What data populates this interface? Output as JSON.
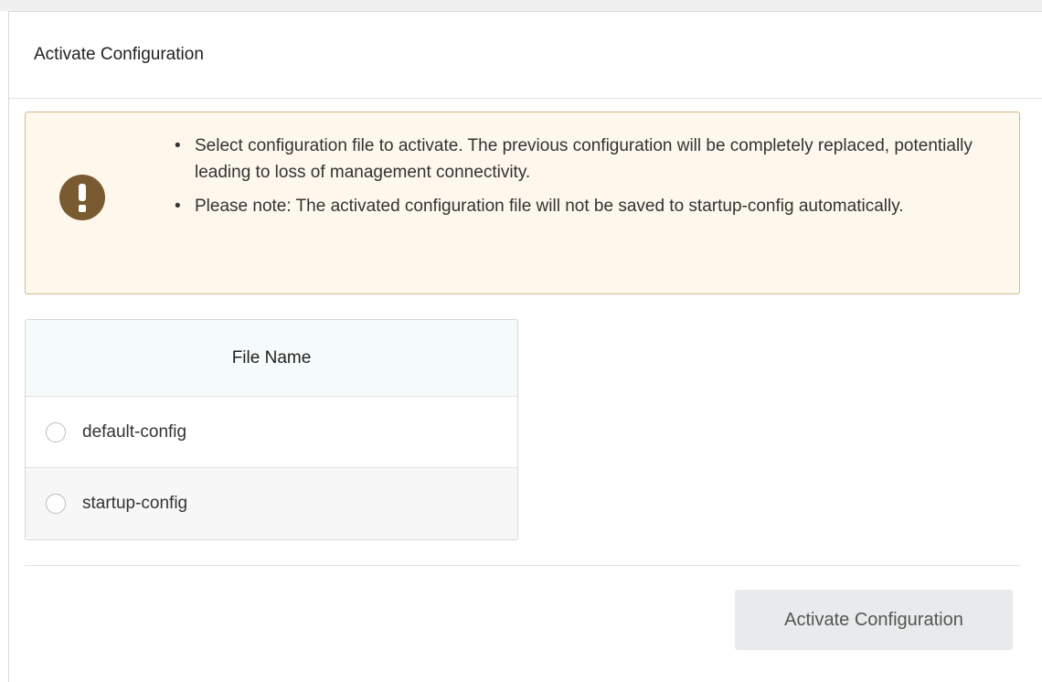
{
  "panel": {
    "title": "Activate Configuration"
  },
  "warning": {
    "icon": "exclamation-circle-icon",
    "items": [
      "Select configuration file to activate. The previous configuration will be completely replaced, potentially leading to loss of management connectivity.",
      "Please note: The activated configuration file will not be saved to startup-config automatically."
    ]
  },
  "file_table": {
    "header": "File Name",
    "rows": [
      {
        "name": "default-config",
        "selected": false
      },
      {
        "name": "startup-config",
        "selected": false
      }
    ]
  },
  "footer": {
    "activate_label": "Activate Configuration"
  },
  "colors": {
    "warning_background": "#fdf7ec",
    "warning_border": "#d4b98a",
    "warning_icon": "#7a5a30",
    "table_header_background": "#f5fafa",
    "button_disabled_background": "#e8ebeb"
  }
}
